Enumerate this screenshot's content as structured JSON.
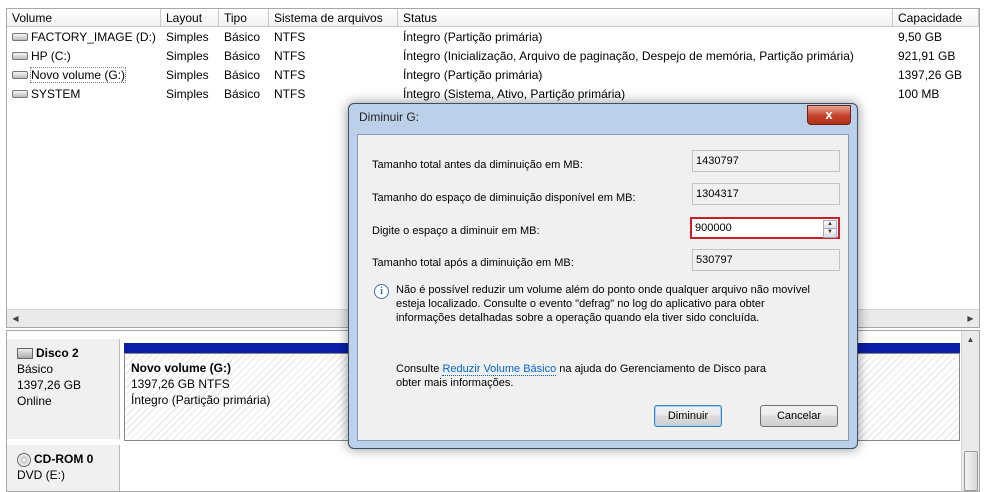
{
  "volume_list": {
    "columns": [
      "Volume",
      "Layout",
      "Tipo",
      "Sistema de arquivos",
      "Status",
      "Capacidade"
    ],
    "rows": [
      {
        "volume": "FACTORY_IMAGE (D:)",
        "layout": "Simples",
        "tipo": "Básico",
        "fs": "NTFS",
        "status": "Íntegro (Partição primária)",
        "capacidade": "9,50 GB"
      },
      {
        "volume": "HP (C:)",
        "layout": "Simples",
        "tipo": "Básico",
        "fs": "NTFS",
        "status": "Íntegro (Inicialização, Arquivo de paginação, Despejo de memória, Partição primária)",
        "capacidade": "921,91 GB"
      },
      {
        "volume": "Novo volume (G:)",
        "layout": "Simples",
        "tipo": "Básico",
        "fs": "NTFS",
        "status": "Íntegro (Partição primária)",
        "capacidade": "1397,26 GB"
      },
      {
        "volume": "SYSTEM",
        "layout": "Simples",
        "tipo": "Básico",
        "fs": "NTFS",
        "status": "Íntegro (Sistema, Ativo, Partição primária)",
        "capacidade": "100 MB"
      }
    ]
  },
  "disks": [
    {
      "name": "Disco 2",
      "type": "Básico",
      "size": "1397,26 GB",
      "state": "Online",
      "partition": {
        "name": "Novo volume  (G:)",
        "detail": "1397,26 GB NTFS",
        "status": "Íntegro (Partição primária)"
      }
    },
    {
      "name": "CD-ROM 0",
      "type": "DVD (E:)"
    }
  ],
  "dialog": {
    "title": "Diminuir G:",
    "close_label": "x",
    "total_before_label": "Tamanho total antes da diminuição em MB:",
    "total_before_value": "1430797",
    "available_label": "Tamanho do espaço de diminuição disponível em MB:",
    "available_value": "1304317",
    "enter_label": "Digite o espaço a diminuir em MB:",
    "enter_value": "900000",
    "total_after_label": "Tamanho total após a diminuição em MB:",
    "total_after_value": "530797",
    "info_line1": "Não é possível reduzir um volume além do ponto onde qualquer arquivo não movível",
    "info_line2": "esteja localizado. Consulte o evento \"defrag\" no log do aplicativo para obter",
    "info_line3": "informações detalhadas sobre a operação quando ela tiver sido concluída.",
    "help_prefix": "Consulte",
    "help_link": "Reduzir Volume Básico",
    "help_suffix": "na ajuda do Gerenciamento de Disco para",
    "help_line2": "obter mais informações.",
    "shrink_button": "Diminuir",
    "cancel_button": "Cancelar"
  },
  "colors": {
    "partition_bar": "#0b1ea8",
    "error_border": "#c8202a",
    "link": "#0066cc"
  }
}
